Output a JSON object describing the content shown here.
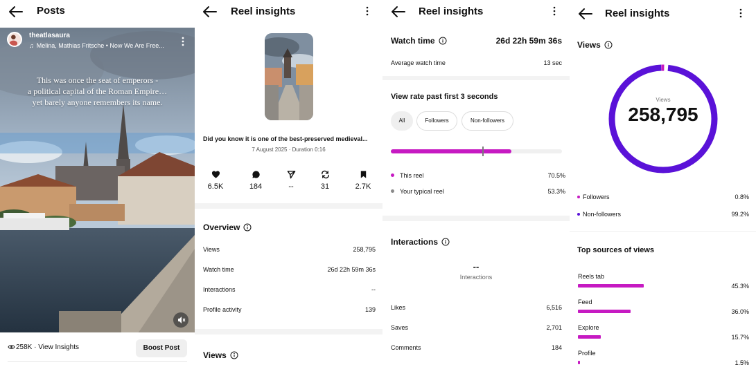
{
  "colors": {
    "accent": "#c61ac2",
    "ring": "#5a12d8",
    "ring_accent": "#c61ac2",
    "text": "#111111"
  },
  "posts": {
    "title": "Posts",
    "username": "theatlasaura",
    "music": "Melina, Mathias Fritsche • Now We Are Free...",
    "overlay_caption_lines": [
      "This was once the seat of emperors -",
      "a political capital of the Roman Empire…",
      "yet barely anyone remembers its name."
    ],
    "views_insights": "258K · View Insights",
    "boost_label": "Boost Post"
  },
  "reel1": {
    "title": "Reel insights",
    "post_title": "Did you know it is one of the best-preserved medieval...",
    "meta": "7 August 2025 · Duration 0:16",
    "stats": [
      {
        "icon": "heart-icon",
        "value": "6.5K"
      },
      {
        "icon": "comment-icon",
        "value": "184"
      },
      {
        "icon": "share-icon",
        "value": "--"
      },
      {
        "icon": "repost-icon",
        "value": "31"
      },
      {
        "icon": "bookmark-icon",
        "value": "2.7K"
      }
    ],
    "overview_title": "Overview",
    "overview_rows": [
      {
        "label": "Views",
        "value": "258,795"
      },
      {
        "label": "Watch time",
        "value": "26d 22h 59m 36s"
      },
      {
        "label": "Interactions",
        "value": "--"
      },
      {
        "label": "Profile activity",
        "value": "139"
      }
    ],
    "views_title": "Views"
  },
  "reel2": {
    "title": "Reel insights",
    "watch_time_label": "Watch time",
    "watch_time_value": "26d 22h 59m 36s",
    "avg_label": "Average watch time",
    "avg_value": "13 sec",
    "view_rate_title": "View rate past first 3 seconds",
    "chips": [
      "All",
      "Followers",
      "Non-followers"
    ],
    "this_reel_pct": 70.5,
    "typical_pct": 53.3,
    "legend": [
      {
        "label": "This reel",
        "value": "70.5%"
      },
      {
        "label": "Your typical reel",
        "value": "53.3%"
      }
    ],
    "interactions_title": "Interactions",
    "interactions_value": "--",
    "interactions_label": "Interactions",
    "interaction_rows": [
      {
        "label": "Likes",
        "value": "6,516"
      },
      {
        "label": "Saves",
        "value": "2,701"
      },
      {
        "label": "Comments",
        "value": "184"
      }
    ]
  },
  "reel3": {
    "title": "Reel insights",
    "views_title": "Views",
    "ring_label": "Views",
    "ring_value": "258,795",
    "followers_pct": 0.8,
    "audience": [
      {
        "label": "Followers",
        "value": "0.8%"
      },
      {
        "label": "Non-followers",
        "value": "99.2%"
      }
    ],
    "sources_title": "Top sources of views",
    "sources": [
      {
        "label": "Reels tab",
        "value": "45.3%",
        "pct": 45.3
      },
      {
        "label": "Feed",
        "value": "36.0%",
        "pct": 36.0
      },
      {
        "label": "Explore",
        "value": "15.7%",
        "pct": 15.7
      },
      {
        "label": "Profile",
        "value": "1.5%",
        "pct": 1.5
      }
    ]
  }
}
